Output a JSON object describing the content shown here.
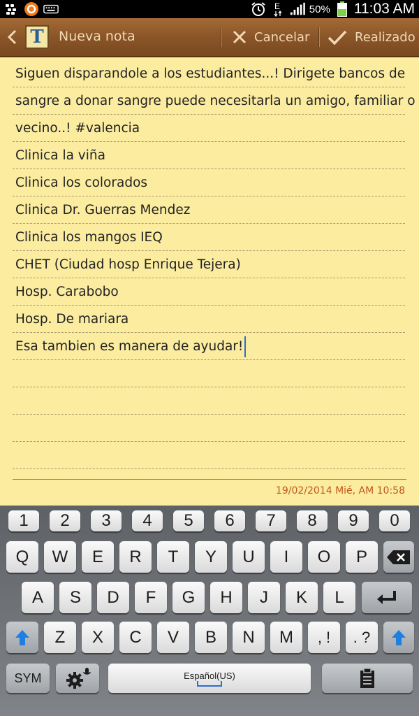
{
  "status_bar": {
    "battery_percent": "50%",
    "time": "11:03 AM",
    "icons": [
      "bbm-icon",
      "app-notification-icon",
      "keyboard-icon",
      "alarm-icon",
      "data-e-icon",
      "signal-icon",
      "battery-icon"
    ]
  },
  "header": {
    "title": "Nueva nota",
    "cancel_label": "Cancelar",
    "done_label": "Realizado"
  },
  "note": {
    "lines": [
      "Siguen disparandole a los estudiantes...! Dirigete bancos de",
      "sangre a donar sangre puede necesitarla un amigo, familiar o",
      "vecino..! #valencia",
      "Clinica la viña",
      "Clinica los colorados",
      "Clinica Dr. Guerras Mendez",
      "Clinica los mangos IEQ",
      "CHET (Ciudad hosp Enrique Tejera)",
      "Hosp. Carabobo",
      "Hosp. De mariara",
      "Esa tambien es manera de ayudar!",
      "",
      "",
      "",
      ""
    ],
    "date": "19/02/2014 Mié, AM 10:58"
  },
  "keyboard": {
    "row_numbers": [
      "1",
      "2",
      "3",
      "4",
      "5",
      "6",
      "7",
      "8",
      "9",
      "0"
    ],
    "row_q": [
      "Q",
      "W",
      "E",
      "R",
      "T",
      "Y",
      "U",
      "I",
      "O",
      "P"
    ],
    "row_a": [
      "A",
      "S",
      "D",
      "F",
      "G",
      "H",
      "J",
      "K",
      "L"
    ],
    "row_z": [
      "Z",
      "X",
      "C",
      "V",
      "B",
      "N",
      "M"
    ],
    "comma_key": ", !",
    "period_key": ". ?",
    "sym_label": "SYM",
    "space_label": "Español(US)"
  },
  "colors": {
    "note_background": "#fbeca0",
    "header_wood": "#8a5528",
    "date_text": "#c0571a",
    "cursor": "#2b6cd6",
    "shift_arrow": "#1f7fe0"
  }
}
